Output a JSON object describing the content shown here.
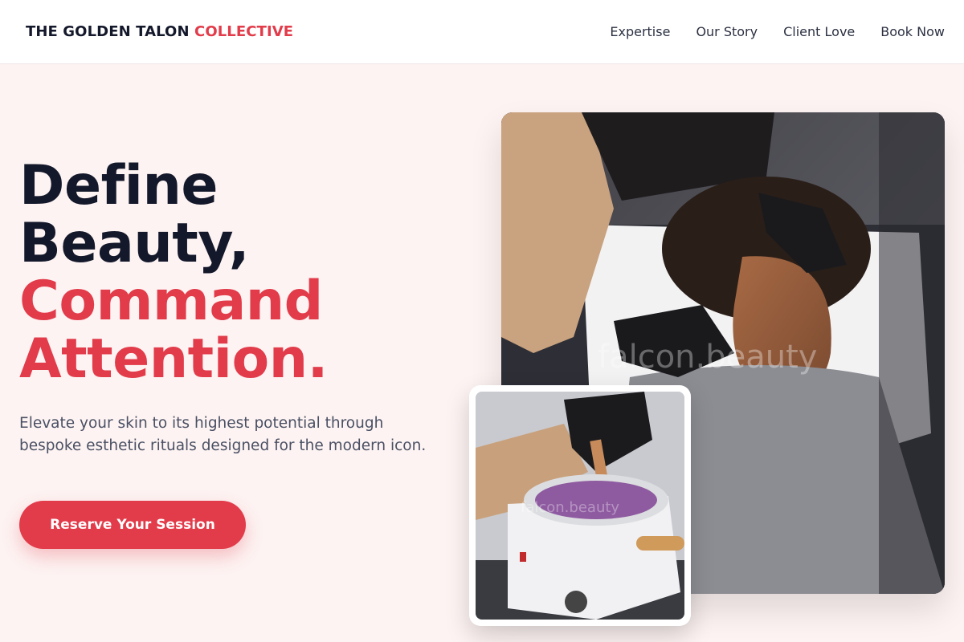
{
  "brand": {
    "name_main": "THE GOLDEN TALON",
    "name_accent": "COLLECTIVE",
    "accent_color": "#e23b4a"
  },
  "nav": {
    "items": [
      {
        "label": "Expertise"
      },
      {
        "label": "Our Story"
      },
      {
        "label": "Client Love"
      },
      {
        "label": "Book Now"
      }
    ]
  },
  "hero": {
    "headline": {
      "line1": "Define",
      "line2": "Beauty,",
      "line3": "Command",
      "line4": "Attention."
    },
    "subtitle": "Elevate your skin to its highest potential through bespoke esthetic rituals designed for the modern icon.",
    "cta_label": "Reserve Your Session"
  },
  "images": {
    "main": {
      "watermark": "falcon.beauty",
      "icon": "esthetician-brow-treatment-photo"
    },
    "secondary": {
      "watermark": "falcon.beauty",
      "icon": "wax-warmer-photo"
    }
  }
}
